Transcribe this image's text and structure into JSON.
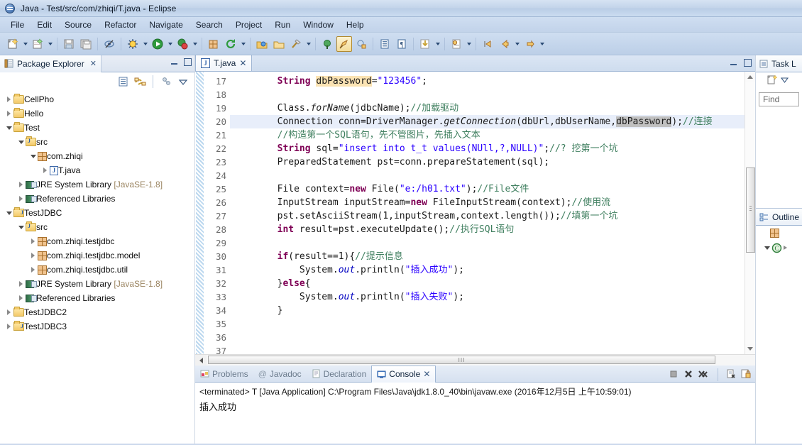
{
  "window": {
    "title": "Java - Test/src/com/zhiqi/T.java - Eclipse",
    "app_icon": "eclipse-icon"
  },
  "menu": {
    "items": [
      "File",
      "Edit",
      "Source",
      "Refactor",
      "Navigate",
      "Search",
      "Project",
      "Run",
      "Window",
      "Help"
    ]
  },
  "toolbar": {
    "buttons": [
      {
        "name": "new-wizard-icon",
        "has_arrow": true
      },
      {
        "name": "new-java-project-icon",
        "has_arrow": true
      },
      {
        "name": "save-icon",
        "has_arrow": false
      },
      {
        "name": "save-all-icon",
        "has_arrow": false
      },
      {
        "name": "toggle-mark-occurrences-icon",
        "has_arrow": false
      },
      {
        "name": "debug-icon",
        "has_arrow": true
      },
      {
        "name": "run-icon",
        "has_arrow": true
      },
      {
        "name": "run-external-tools-icon",
        "has_arrow": true
      },
      {
        "name": "new-java-package-icon",
        "has_arrow": false
      },
      {
        "name": "refresh-icon",
        "has_arrow": true
      },
      {
        "name": "open-type-icon",
        "has_arrow": false
      },
      {
        "name": "open-task-icon",
        "has_arrow": false
      },
      {
        "name": "search-icon",
        "has_arrow": true
      },
      {
        "name": "next-annotation-icon",
        "has_arrow": false
      },
      {
        "name": "pin-editor-icon",
        "has_arrow": false
      },
      {
        "name": "toggle-block-selection-icon",
        "has_arrow": false
      },
      {
        "name": "show-whitespace-icon",
        "has_arrow": false
      },
      {
        "name": "download-icon",
        "has_arrow": true
      },
      {
        "name": "quick-access-icon",
        "has_arrow": true
      },
      {
        "name": "back-history-icon",
        "has_arrow": false
      },
      {
        "name": "back-icon",
        "has_arrow": true
      },
      {
        "name": "forward-icon",
        "has_arrow": true
      }
    ]
  },
  "package_explorer": {
    "tab_label": "Package Explorer",
    "close_label": "✕",
    "toolbar_icons": [
      "collapse-all-icon",
      "link-with-editor-icon",
      "focus-on-active-task-icon",
      "view-menu-icon"
    ],
    "tree": [
      {
        "label": "CellPho",
        "depth": 0,
        "twist": "closed",
        "icon": "project-folder-icon",
        "dim": ""
      },
      {
        "label": "Hello",
        "depth": 0,
        "twist": "closed",
        "icon": "project-folder-icon",
        "dim": ""
      },
      {
        "label": "Test",
        "depth": 0,
        "twist": "open",
        "icon": "project-folder-icon",
        "dim": ""
      },
      {
        "label": "src",
        "depth": 1,
        "twist": "open",
        "icon": "source-folder-icon",
        "dim": ""
      },
      {
        "label": "com.zhiqi",
        "depth": 2,
        "twist": "open",
        "icon": "package-icon",
        "dim": ""
      },
      {
        "label": "T.java",
        "depth": 3,
        "twist": "closed",
        "icon": "java-file-icon",
        "dim": ""
      },
      {
        "label": "JRE System Library",
        "depth": 1,
        "twist": "closed",
        "icon": "library-icon",
        "dim": "[JavaSE-1.8]"
      },
      {
        "label": "Referenced Libraries",
        "depth": 1,
        "twist": "closed",
        "icon": "library-icon",
        "dim": ""
      },
      {
        "label": "TestJDBC",
        "depth": 0,
        "twist": "open",
        "icon": "java-project-icon",
        "dim": ""
      },
      {
        "label": "src",
        "depth": 1,
        "twist": "open",
        "icon": "source-folder-icon",
        "dim": ""
      },
      {
        "label": "com.zhiqi.testjdbc",
        "depth": 2,
        "twist": "closed",
        "icon": "package-icon",
        "dim": ""
      },
      {
        "label": "com.zhiqi.testjdbc.model",
        "depth": 2,
        "twist": "closed",
        "icon": "package-icon",
        "dim": ""
      },
      {
        "label": "com.zhiqi.testjdbc.util",
        "depth": 2,
        "twist": "closed",
        "icon": "package-icon",
        "dim": ""
      },
      {
        "label": "JRE System Library",
        "depth": 1,
        "twist": "closed",
        "icon": "library-icon",
        "dim": "[JavaSE-1.8]"
      },
      {
        "label": "Referenced Libraries",
        "depth": 1,
        "twist": "closed",
        "icon": "library-icon",
        "dim": ""
      },
      {
        "label": "TestJDBC2",
        "depth": 0,
        "twist": "closed",
        "icon": "project-folder-icon",
        "dim": ""
      },
      {
        "label": "TestJDBC3",
        "depth": 0,
        "twist": "closed",
        "icon": "java-project-icon",
        "dim": ""
      }
    ]
  },
  "editor": {
    "tab_label": "T.java",
    "tab_close": "✕",
    "first_line": 17,
    "lines": [
      {
        "n": 17,
        "html": "        <span class=\"kw\">String</span> <span class=\"hlw\">dbPassword</span>=<span class=\"st\">\"123456\"</span>;",
        "highlight": false
      },
      {
        "n": 18,
        "html": "",
        "highlight": false
      },
      {
        "n": 19,
        "html": "        Class.<span class=\"it\">forName</span>(jdbcName);<span class=\"cm\">//加载驱动</span>",
        "highlight": false
      },
      {
        "n": 20,
        "html": "        Connection conn=DriverManager.<span class=\"it\">getConnection</span>(dbUrl,dbUserName,<span class=\"caret\"></span><span class=\"selw\">dbPassword</span>);<span class=\"cm\">//连接</span>",
        "highlight": true
      },
      {
        "n": 21,
        "html": "        <span class=\"cm\">//构造第一个SQL语句，先不管图片，先插入文本</span>",
        "highlight": false
      },
      {
        "n": 22,
        "html": "        <span class=\"kw\">String</span> sql=<span class=\"st\">\"insert into t_t values(NUll,?,NULL)\"</span>;<span class=\"cm\">//? 挖第一个坑</span>",
        "highlight": false
      },
      {
        "n": 23,
        "html": "        PreparedStatement pst=conn.prepareStatement(sql);",
        "highlight": false
      },
      {
        "n": 24,
        "html": "",
        "highlight": false
      },
      {
        "n": 25,
        "html": "        File context=<span class=\"kw\">new</span> File(<span class=\"st\">\"e:/h01.txt\"</span>);<span class=\"cm\">//File文件</span>",
        "highlight": false
      },
      {
        "n": 26,
        "html": "        InputStream inputStream=<span class=\"kw\">new</span> FileInputStream(context);<span class=\"cm\">//使用流</span>",
        "highlight": false
      },
      {
        "n": 27,
        "html": "        pst.setAsciiStream(1,inputStream,context.length());<span class=\"cm\">//填第一个坑</span>",
        "highlight": false
      },
      {
        "n": 28,
        "html": "        <span class=\"kw\">int</span> result=pst.executeUpdate();<span class=\"cm\">//执行SQL语句</span>",
        "highlight": false
      },
      {
        "n": 29,
        "html": "",
        "highlight": false
      },
      {
        "n": 30,
        "html": "        <span class=\"kw\">if</span>(result==1){<span class=\"cm\">//提示信息</span>",
        "highlight": false
      },
      {
        "n": 31,
        "html": "            System.<span class=\"it fld\">out</span>.println(<span class=\"st\">\"插入成功\"</span>);",
        "highlight": false
      },
      {
        "n": 32,
        "html": "        }<span class=\"kw\">else</span>{",
        "highlight": false
      },
      {
        "n": 33,
        "html": "            System.<span class=\"it fld\">out</span>.println(<span class=\"st\">\"插入失败\"</span>);",
        "highlight": false
      },
      {
        "n": 34,
        "html": "        }",
        "highlight": false
      },
      {
        "n": 35,
        "html": "",
        "highlight": false
      },
      {
        "n": 36,
        "html": "",
        "highlight": false
      },
      {
        "n": 37,
        "html": "",
        "highlight": false
      }
    ]
  },
  "console": {
    "tabs": [
      {
        "label": "Problems",
        "icon": "problems-icon",
        "active": false
      },
      {
        "label": "Javadoc",
        "icon": "javadoc-icon",
        "active": false
      },
      {
        "label": "Declaration",
        "icon": "declaration-icon",
        "active": false
      },
      {
        "label": "Console",
        "icon": "console-icon",
        "active": true
      }
    ],
    "close_label": "✕",
    "toolbar_icons": [
      "terminate-icon",
      "remove-launch-icon",
      "remove-all-terminated-icon",
      "clear-console-icon",
      "scroll-lock-icon"
    ],
    "launch_line": "<terminated> T [Java Application] C:\\Program Files\\Java\\jdk1.8.0_40\\bin\\javaw.exe (2016年12月5日 上午10:59:01)",
    "output": "插入成功"
  },
  "task_list": {
    "tab_label": "Task L",
    "toolbar_icons": [
      "new-task-icon",
      "view-menu-icon"
    ],
    "find_placeholder": "Find"
  },
  "outline": {
    "tab_label": "Outline",
    "items": [
      {
        "icon": "package-icon",
        "label": ""
      },
      {
        "icon": "class-icon",
        "label": ""
      }
    ]
  },
  "colors": {
    "chrome": "#cbdcf0",
    "accent": "#2a5ea8",
    "keyword": "#7f0055",
    "string": "#2a00ff",
    "comment": "#3f7f5f",
    "occurrence_highlight": "#fbe3b3",
    "line_highlight": "#e8eefa"
  }
}
